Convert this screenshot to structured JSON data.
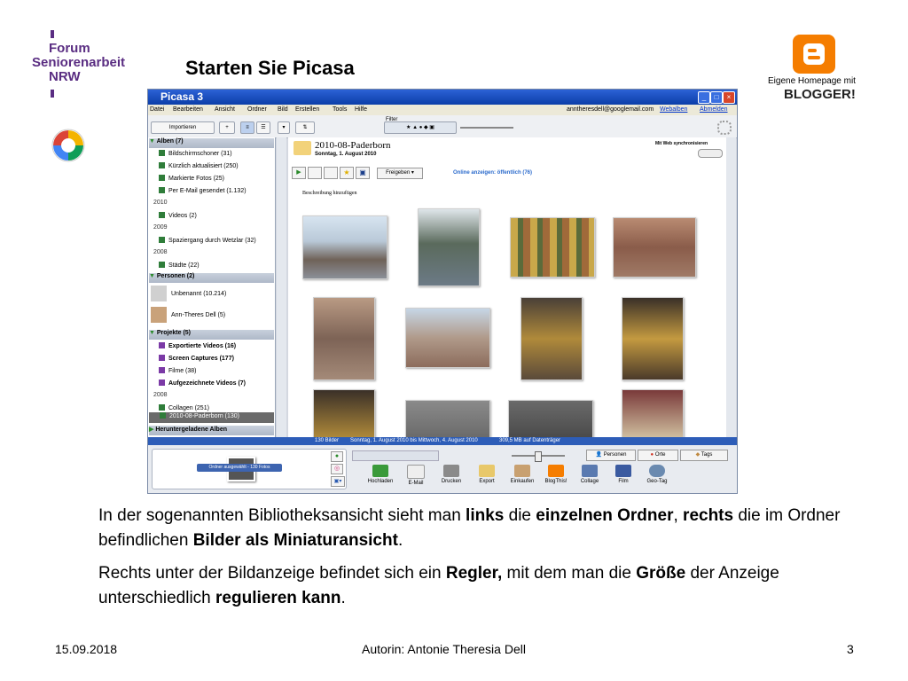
{
  "slide": {
    "title": "Starten Sie Picasa",
    "org_lines": [
      "Forum",
      "Seniorenarbeit",
      "NRW"
    ],
    "blogger_caption": "Eigene Homepage mit",
    "blogger_word": "BLOGGER!",
    "paragraphs": [
      [
        {
          "text": "In der sogenannten Bibliotheksansicht sieht man ",
          "bold": false
        },
        {
          "text": "links",
          "bold": true
        },
        {
          "text": " die ",
          "bold": false
        },
        {
          "text": "einzelnen Ordner",
          "bold": true
        },
        {
          "text": ",  ",
          "bold": false
        },
        {
          "text": "rechts",
          "bold": true
        },
        {
          "text": " die im Ordner befindlichen ",
          "bold": false
        },
        {
          "text": "Bilder als Miniaturansicht",
          "bold": true
        },
        {
          "text": ".",
          "bold": false
        }
      ],
      [
        {
          "text": "Rechts unter der Bildanzeige befindet sich ein ",
          "bold": false
        },
        {
          "text": "Regler,",
          "bold": true
        },
        {
          "text": " mit dem man die ",
          "bold": false
        },
        {
          "text": "Größe",
          "bold": true
        },
        {
          "text": " der Anzeige unterschiedlich ",
          "bold": false
        },
        {
          "text": "regulieren kann",
          "bold": true
        },
        {
          "text": ".",
          "bold": false
        }
      ]
    ],
    "footer": {
      "date": "15.09.2018",
      "author": "Autorin: Antonie Theresia Dell",
      "page": "3"
    },
    "colors": {
      "brand_purple": "#5a2d82",
      "blogger_orange": "#f57d00"
    }
  },
  "picasa": {
    "window_title": "Picasa 3",
    "menu": [
      "Datei",
      "Bearbeiten",
      "Ansicht",
      "Ordner",
      "Bild",
      "Erstellen",
      "Tools",
      "Hilfe"
    ],
    "account": "anntheresdell@googlemail.com",
    "webalben": "Webalben",
    "abmelden": "Abmelden",
    "import_label": "Importieren",
    "filter_label": "Filter",
    "sections": {
      "alben": "Alben (7)",
      "personen": "Personen (2)",
      "projekte": "Projekte (5)",
      "downloads": "Heruntergeladene Alben"
    },
    "alben_items": [
      "Bildschirmschoner (31)",
      "Kürzlich aktualisiert (250)",
      "Markierte Fotos (25)",
      "Per E-Mail gesendet (1.132)"
    ],
    "year_2010": "2010",
    "videos": "Videos (2)",
    "year_2009": "2009",
    "spaziergang": "Spaziergang durch Wetzlar (32)",
    "year_2008": "2008",
    "staedte": "Städte (22)",
    "personen_items": [
      "Unbenannt (10.214)",
      "Ann-Theres Dell (5)"
    ],
    "projekte_items": [
      "Exportierte Videos (16)",
      "Screen Captures (177)",
      "Filme (38)",
      "Aufgezeichnete Videos (7)"
    ],
    "year_2008b": "2008",
    "collagen": "Collagen (251)",
    "selected_folder": "2010-08-Paderborn (130)",
    "folder_title": "2010-08-Paderborn",
    "folder_date": "Sonntag, 1. August 2010",
    "sync_label": "Mit Web synchronisieren",
    "share_label": "Freigeben",
    "online_label": "Online anzeigen: öffentlich (76)",
    "add_description": "Beschreibung hinzufügen",
    "status": [
      "130 Bilder",
      "Sonntag, 1. August 2010 bis Mittwoch, 4. August 2010",
      "309,5 MB auf Datenträger"
    ],
    "tray_label": "Ordner ausgewählt - 130 Fotos",
    "tags": [
      "Personen",
      "Orte",
      "Tags"
    ],
    "bottom_buttons": [
      "Hochladen",
      "E-Mail",
      "Drucken",
      "Export",
      "Einkaufen",
      "BlogThis!",
      "Collage",
      "Film",
      "Geo-Tag"
    ]
  }
}
